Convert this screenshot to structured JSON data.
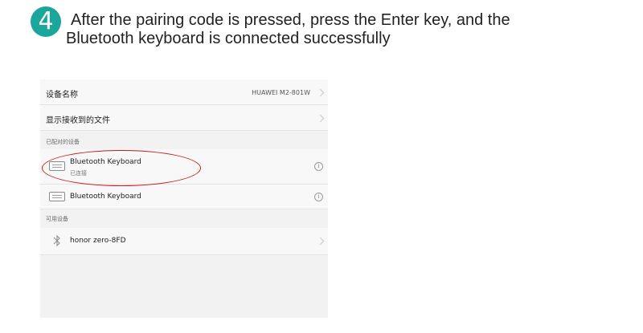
{
  "step": {
    "number": "4",
    "line1": "After the pairing code is pressed, press the Enter key, and the",
    "line2": "Bluetooth keyboard is connected successfully"
  },
  "settings": {
    "device_name_label": "设备名称",
    "device_name_value": "HUAWEI M2-801W",
    "show_received_label": "显示接收到的文件",
    "paired_section": "已配对的设备",
    "paired_devices": [
      {
        "name": "Bluetooth Keyboard",
        "status": "已连接",
        "icon": "keyboard-icon"
      },
      {
        "name": "Bluetooth Keyboard",
        "status": "",
        "icon": "keyboard-icon"
      }
    ],
    "available_section": "可用设备",
    "available_devices": [
      {
        "name": "honor zero-8FD",
        "icon": "bluetooth-icon"
      }
    ],
    "info_glyph": "i"
  },
  "colors": {
    "badge": "#1aa69b",
    "highlight": "#c81818"
  }
}
